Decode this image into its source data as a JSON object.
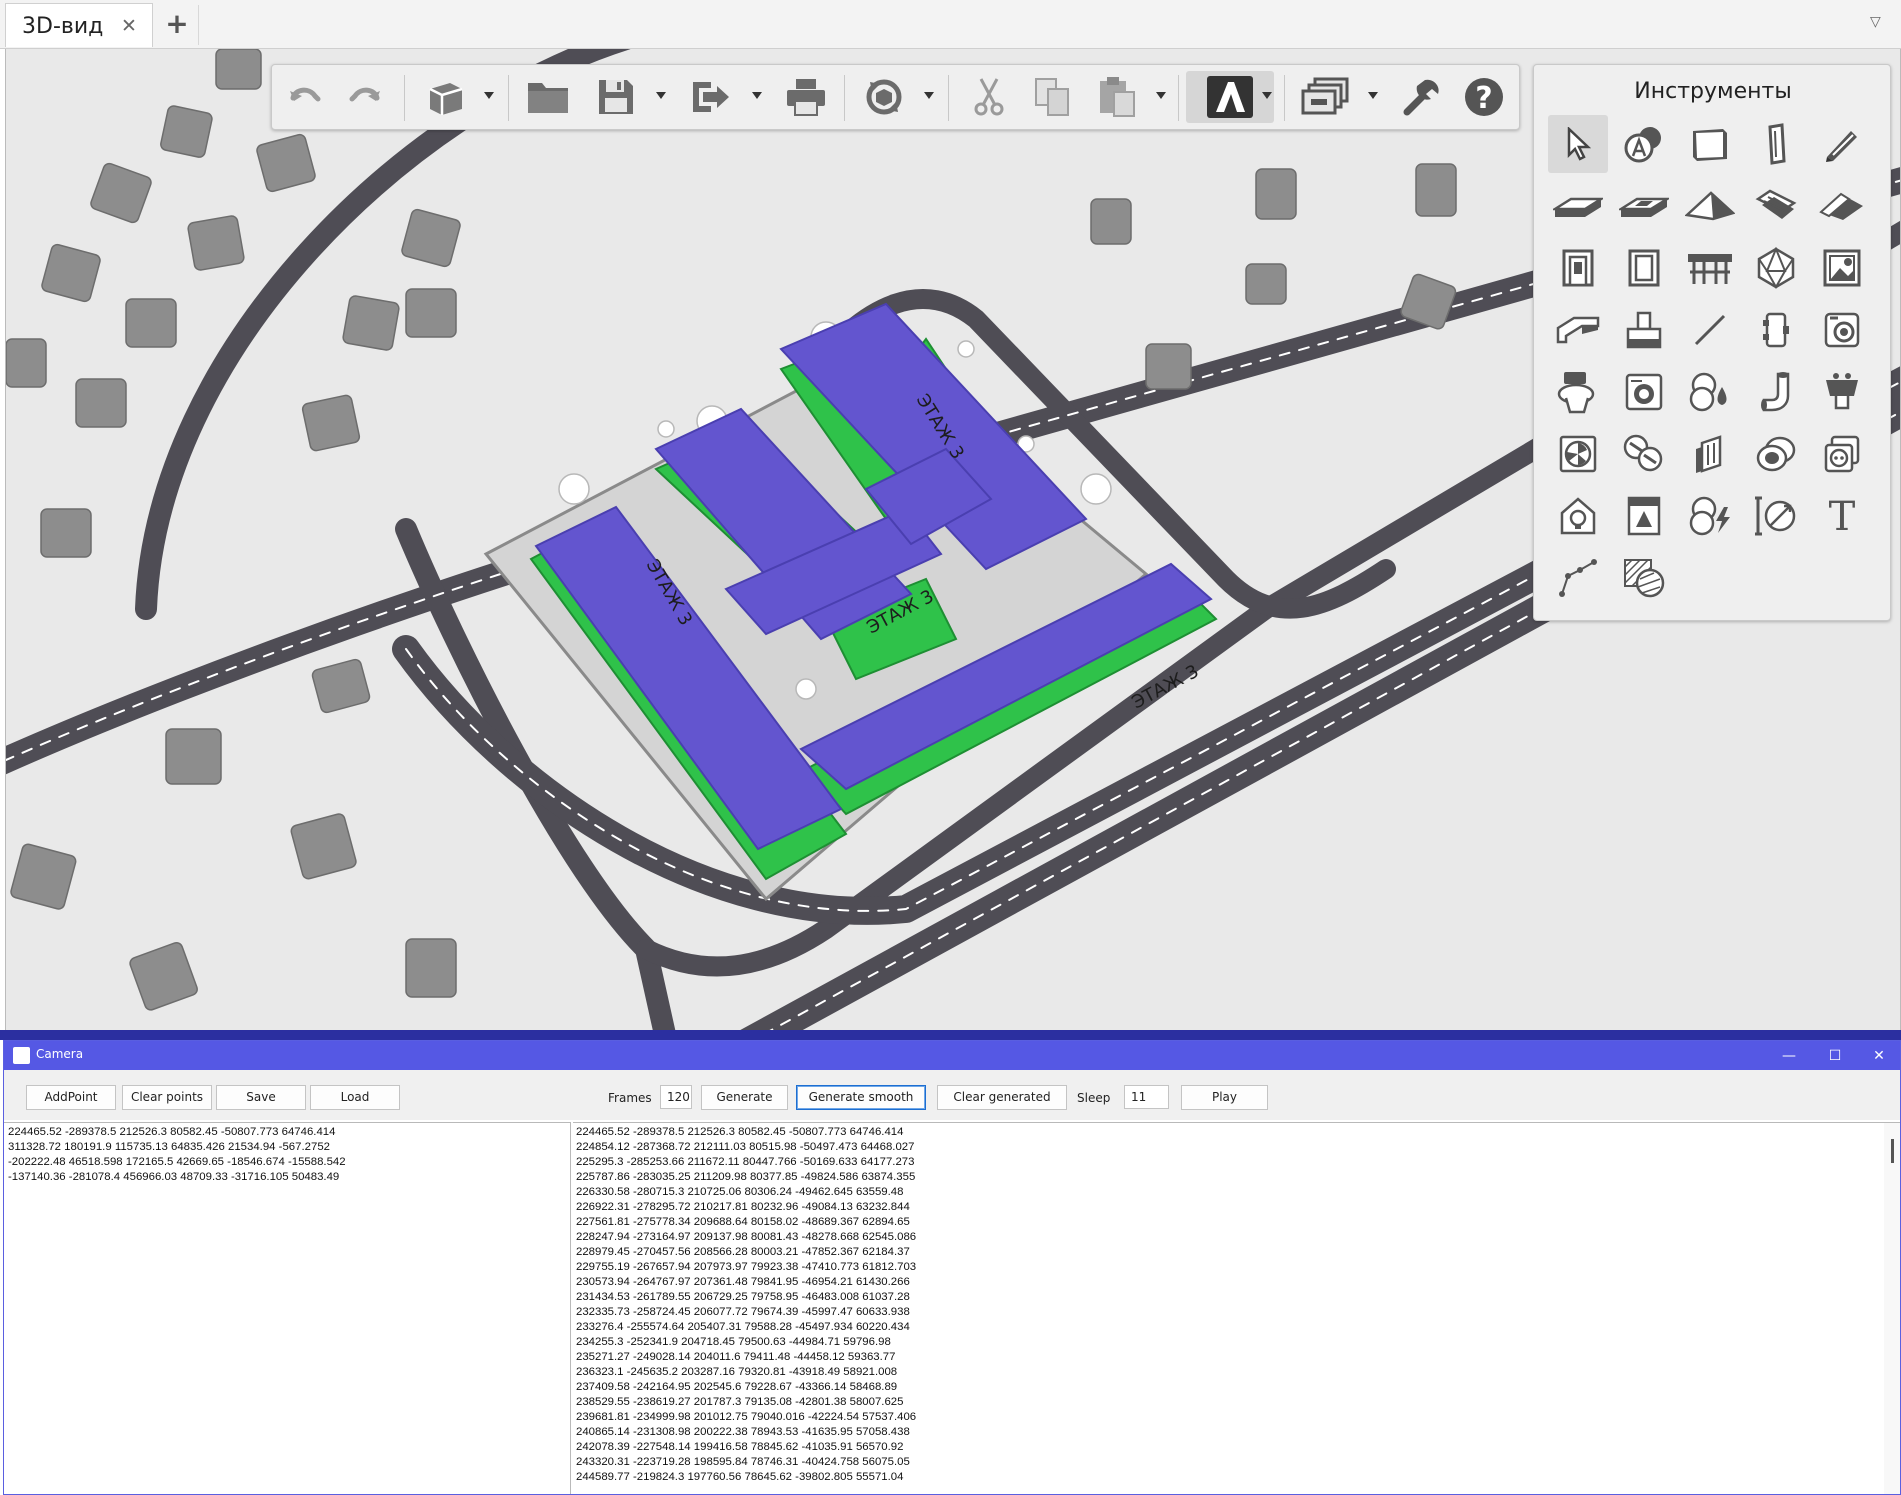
{
  "tab": {
    "title": "3D-вид",
    "close": "✕",
    "add": "+",
    "overflow": "▽"
  },
  "viewport": {
    "background": "#e9e9e9",
    "road_color": "#4f4d55",
    "building_color": "#6355cf",
    "floor_color": "#2fc24a",
    "floor_labels": [
      "ЭТАЖ 3",
      "ЭТАЖ 3",
      "ЭТАЖ 3",
      "ЭТАЖ 3"
    ]
  },
  "toolbar": {
    "items": [
      "undo-icon",
      "redo-icon",
      "cube-view-icon",
      "open-folder-icon",
      "save-icon",
      "export-icon",
      "print-icon",
      "rotate-view-icon",
      "cut-icon",
      "copy-icon",
      "paste-icon",
      "lira-logo-icon",
      "layers-icon",
      "settings-wrench-icon",
      "help-icon"
    ],
    "help_label": "?"
  },
  "tools": {
    "title": "Инструменты",
    "text_tool_label": "T",
    "items": [
      "pointer-icon",
      "annotation-icon",
      "wall-icon",
      "column-icon",
      "pencil-icon",
      "slab-icon",
      "floor-opening-icon",
      "roof-icon",
      "stairs-icon",
      "ramp-icon",
      "door-icon",
      "window-icon",
      "railing-icon",
      "polyhedron-icon",
      "picture-icon",
      "duct-icon",
      "equipment-icon",
      "line-icon",
      "fitting-icon",
      "valve-icon",
      "toilet-icon",
      "washing-machine-icon",
      "pump-icon",
      "pipe-elbow-icon",
      "sink-icon",
      "fan-icon",
      "heat-exchanger-icon",
      "radiator-icon",
      "cable-coil-icon",
      "socket-icon",
      "house-lamp-icon",
      "panel-icon",
      "electric-equipment-icon",
      "dimension-icon",
      "text-icon",
      "polyline-icon",
      "hatch-icon"
    ]
  },
  "camera": {
    "title": "Camera",
    "buttons": {
      "add_point": "AddPoint",
      "clear_points": "Clear points",
      "save": "Save",
      "load": "Load",
      "generate": "Generate",
      "generate_smooth": "Generate smooth",
      "clear_generated": "Clear generated",
      "play": "Play"
    },
    "frames_label": "Frames",
    "frames_value": "120",
    "sleep_label": "Sleep",
    "sleep_value": "11",
    "window_controls": {
      "minimize": "—",
      "maximize": "☐",
      "close": "✕"
    },
    "points": [
      "224465.52 -289378.5 212526.3 80582.45 -50807.773 64746.414",
      "311328.72 180191.9 115735.13 64835.426 21534.94 -567.2752",
      "-202222.48 46518.598 172165.5 42669.65 -18546.674 -15588.542",
      "-137140.36 -281078.4 456966.03 48709.33 -31716.105 50483.49"
    ],
    "generated": [
      "224465.52 -289378.5 212526.3 80582.45 -50807.773 64746.414",
      "224854.12 -287368.72 212111.03 80515.98 -50497.473 64468.027",
      "225295.3 -285253.66 211672.11 80447.766 -50169.633 64177.273",
      "225787.86 -283035.25 211209.98 80377.85 -49824.586 63874.355",
      "226330.58 -280715.3 210725.06 80306.24 -49462.645 63559.48",
      "226922.31 -278295.72 210217.81 80232.96 -49084.13 63232.844",
      "227561.81 -275778.34 209688.64 80158.02 -48689.367 62894.65",
      "228247.94 -273164.97 209137.98 80081.43 -48278.668 62545.086",
      "228979.45 -270457.56 208566.28 80003.21 -47852.367 62184.37",
      "229755.19 -267657.94 207973.97 79923.38 -47410.773 61812.703",
      "230573.94 -264767.97 207361.48 79841.95 -46954.21 61430.266",
      "231434.53 -261789.55 206729.25 79758.95 -46483.008 61037.28",
      "232335.73 -258724.45 206077.72 79674.39 -45997.47 60633.938",
      "233276.4 -255574.64 205407.31 79588.28 -45497.934 60220.434",
      "234255.3 -252341.9 204718.45 79500.63 -44984.71 59796.98",
      "235271.27 -249028.14 204011.6 79411.48 -44458.12 59363.77",
      "236323.1 -245635.2 203287.16 79320.81 -43918.49 58921.008",
      "237409.58 -242164.95 202545.6 79228.67 -43366.14 58468.89",
      "238529.55 -238619.27 201787.3 79135.08 -42801.38 58007.625",
      "239681.81 -234999.98 201012.75 79040.016 -42224.54 57537.406",
      "240865.14 -231308.98 200222.38 78943.53 -41635.95 57058.438",
      "242078.39 -227548.14 199416.58 78845.62 -41035.91 56570.92",
      "243320.31 -223719.28 198595.84 78746.31 -40424.758 56075.05",
      "244589.77 -219824.3 197760.56 78645.62 -39802.805 55571.04"
    ]
  }
}
